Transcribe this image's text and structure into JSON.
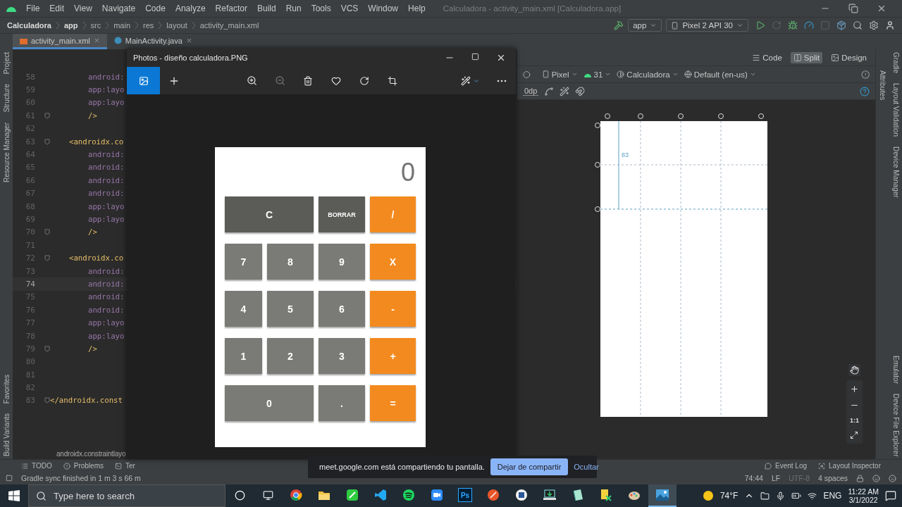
{
  "menu_bar": {
    "items": [
      "File",
      "Edit",
      "View",
      "Navigate",
      "Code",
      "Analyze",
      "Refactor",
      "Build",
      "Run",
      "Tools",
      "VCS",
      "Window",
      "Help"
    ],
    "window_title": "Calculadora - activity_main.xml [Calculadora.app]"
  },
  "breadcrumb": [
    "Calculadora",
    "app",
    "src",
    "main",
    "res",
    "layout",
    "activity_main.xml"
  ],
  "run_toolbar": {
    "module": "app",
    "device": "Pixel 2 API 30"
  },
  "editor_tabs": [
    {
      "label": "activity_main.xml",
      "kind": "xml",
      "selected": true
    },
    {
      "label": "MainActivity.java",
      "kind": "java",
      "selected": false
    }
  ],
  "left_tool_strip": {
    "top": [
      "Project",
      "Structure",
      "Resource Manager"
    ],
    "bottom": [
      "Favorites",
      "Build Variants"
    ]
  },
  "code_lines": [
    {
      "number": "58",
      "text": "android:",
      "kind": "attr",
      "fold_marker": false,
      "current": false
    },
    {
      "number": "59",
      "text": "app:layo",
      "kind": "attr",
      "fold_marker": false,
      "current": false
    },
    {
      "number": "60",
      "text": "app:layo",
      "kind": "attr",
      "fold_marker": false,
      "current": false
    },
    {
      "number": "61",
      "text": "/>",
      "kind": "close",
      "fold_marker": true,
      "current": false
    },
    {
      "number": "62",
      "kind": "blank",
      "fold_marker": false,
      "current": false
    },
    {
      "number": "63",
      "text": "<androidx.co",
      "kind": "tag",
      "fold_marker": true,
      "current": false
    },
    {
      "number": "64",
      "text": "android:",
      "kind": "attr",
      "fold_marker": false,
      "current": false
    },
    {
      "number": "65",
      "text": "android:",
      "kind": "attr",
      "fold_marker": false,
      "current": false
    },
    {
      "number": "66",
      "text": "android:",
      "kind": "attr",
      "fold_marker": false,
      "current": false
    },
    {
      "number": "67",
      "text": "android:",
      "kind": "attr",
      "fold_marker": false,
      "current": false
    },
    {
      "number": "68",
      "text": "app:layo",
      "kind": "attr",
      "fold_marker": false,
      "current": false
    },
    {
      "number": "69",
      "text": "app:layo",
      "kind": "attr",
      "fold_marker": false,
      "current": false
    },
    {
      "number": "70",
      "text": "/>",
      "kind": "close",
      "fold_marker": true,
      "current": false
    },
    {
      "number": "71",
      "kind": "blank",
      "fold_marker": false,
      "current": false
    },
    {
      "number": "72",
      "text": "<androidx.co",
      "kind": "tag",
      "fold_marker": true,
      "current": false
    },
    {
      "number": "73",
      "text": "android:",
      "kind": "attr",
      "fold_marker": false,
      "current": false
    },
    {
      "number": "74",
      "text": "android:",
      "kind": "attr",
      "fold_marker": false,
      "current": true
    },
    {
      "number": "75",
      "text": "android:",
      "kind": "attr",
      "fold_marker": false,
      "current": false
    },
    {
      "number": "76",
      "text": "android:",
      "kind": "attr",
      "fold_marker": false,
      "current": false
    },
    {
      "number": "77",
      "text": "app:layo",
      "kind": "attr",
      "fold_marker": false,
      "current": false
    },
    {
      "number": "78",
      "text": "app:layo",
      "kind": "attr",
      "fold_marker": false,
      "current": false
    },
    {
      "number": "79",
      "text": "/>",
      "kind": "close",
      "fold_marker": true,
      "current": false
    },
    {
      "number": "80",
      "kind": "blank",
      "fold_marker": false,
      "current": false
    },
    {
      "number": "81",
      "kind": "blank",
      "fold_marker": false,
      "current": false
    },
    {
      "number": "82",
      "kind": "blank",
      "fold_marker": false,
      "current": false
    },
    {
      "number": "83",
      "text": "</androidx.const",
      "kind": "root",
      "fold_marker": true,
      "current": false
    }
  ],
  "code_breadcrumb": "androidx.constraintlayo",
  "design": {
    "view_modes": [
      {
        "label": "Code",
        "kind": "code",
        "selected": false
      },
      {
        "label": "Split",
        "kind": "split",
        "selected": true
      },
      {
        "label": "Design",
        "kind": "design",
        "selected": false
      }
    ],
    "device": "Pixel",
    "api": "31",
    "theme": "Calculadora",
    "locale": "Default (en-us)",
    "margin": "0dp",
    "dimension_label": "83",
    "zoom_reset": "1:1"
  },
  "attributes_tab": "Attributes",
  "right_tool_strip": {
    "top": [
      "Gradle",
      "Layout Validation",
      "Device Manager"
    ],
    "bottom": [
      "Emulator",
      "Device File Explorer"
    ]
  },
  "bottom_tools": {
    "left": [
      {
        "label": "TODO",
        "kind": "list"
      },
      {
        "label": "Problems",
        "kind": "problems"
      },
      {
        "label": "Ter",
        "kind": "terminal"
      }
    ],
    "right": [
      {
        "label": "Event Log",
        "kind": "log"
      },
      {
        "label": "Layout Inspector",
        "kind": "inspector"
      }
    ]
  },
  "status_bar": {
    "message": "Gradle sync finished in 1 m 3 s 66 m",
    "position": "74:44",
    "line_ending": "LF",
    "encoding": "UTF-8",
    "indent": "4 spaces"
  },
  "photos_window": {
    "title": "Photos - diseño calculadora.PNG",
    "calculator": {
      "display": "0",
      "buttons": [
        {
          "label": "C",
          "kind": "dark",
          "wide": true
        },
        {
          "label": "BORRAR",
          "kind": "dark",
          "wide": false
        },
        {
          "label": "/",
          "kind": "operator",
          "wide": false
        },
        {
          "label": "7",
          "kind": "digit",
          "wide": false
        },
        {
          "label": "8",
          "kind": "digit",
          "wide": false
        },
        {
          "label": "9",
          "kind": "digit",
          "wide": false
        },
        {
          "label": "X",
          "kind": "operator",
          "wide": false
        },
        {
          "label": "4",
          "kind": "digit",
          "wide": false
        },
        {
          "label": "5",
          "kind": "digit",
          "wide": false
        },
        {
          "label": "6",
          "kind": "digit",
          "wide": false
        },
        {
          "label": "-",
          "kind": "operator",
          "wide": false
        },
        {
          "label": "1",
          "kind": "digit",
          "wide": false
        },
        {
          "label": "2",
          "kind": "digit",
          "wide": false
        },
        {
          "label": "3",
          "kind": "digit",
          "wide": false
        },
        {
          "label": "+",
          "kind": "operator",
          "wide": false
        },
        {
          "label": "0",
          "kind": "digit",
          "wide": true
        },
        {
          "label": ".",
          "kind": "digit",
          "wide": false
        },
        {
          "label": "=",
          "kind": "operator",
          "wide": false
        }
      ]
    }
  },
  "share_bar": {
    "message": "meet.google.com está compartiendo tu pantalla.",
    "stop_button": "Dejar de compartir",
    "hide_link": "Ocultar"
  },
  "taskbar": {
    "search_placeholder": "Type here to search",
    "apps": [
      {
        "kind": "browser",
        "selected": false
      },
      {
        "kind": "folder",
        "selected": false
      },
      {
        "kind": "notes",
        "selected": false
      },
      {
        "kind": "code",
        "selected": false
      },
      {
        "kind": "music",
        "selected": false
      },
      {
        "kind": "video",
        "selected": false
      },
      {
        "kind": "ps",
        "label": "Ps",
        "selected": false
      },
      {
        "kind": "round",
        "selected": false
      },
      {
        "kind": "document",
        "selected": false
      },
      {
        "kind": "download",
        "selected": false
      },
      {
        "kind": "notepad",
        "selected": false
      },
      {
        "kind": "tools",
        "selected": false
      },
      {
        "kind": "palette",
        "selected": false
      },
      {
        "kind": "photos",
        "selected": true
      }
    ],
    "weather": "74°F",
    "language": "ENG",
    "time": "11:22 AM",
    "date": "3/1/2022"
  }
}
